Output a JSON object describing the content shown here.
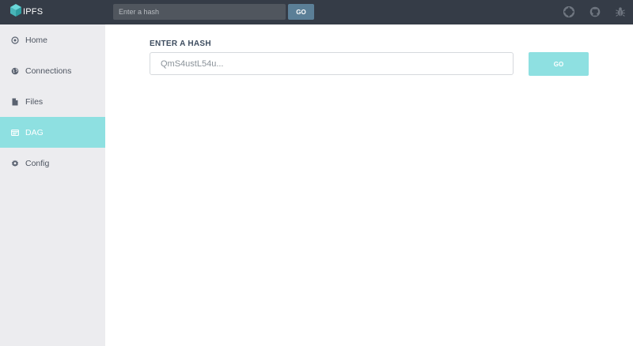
{
  "app": {
    "name": "IPFS",
    "accent_color": "#8ee0e1",
    "header_color": "#353c47"
  },
  "topbar": {
    "search": {
      "placeholder": "Enter a hash",
      "value": ""
    },
    "go_label": "GO",
    "icons": [
      "support-icon",
      "github-icon",
      "bug-icon"
    ]
  },
  "sidebar": {
    "items": [
      {
        "label": "Home",
        "icon": "home-icon",
        "active": false
      },
      {
        "label": "Connections",
        "icon": "globe-icon",
        "active": false
      },
      {
        "label": "Files",
        "icon": "file-icon",
        "active": false
      },
      {
        "label": "DAG",
        "icon": "browser-window-icon",
        "active": true
      },
      {
        "label": "Config",
        "icon": "gear-icon",
        "active": false
      }
    ]
  },
  "main": {
    "section_label": "ENTER A HASH",
    "hash_input": {
      "placeholder": "QmS4ustL54u...",
      "value": ""
    },
    "go_label": "GO"
  }
}
